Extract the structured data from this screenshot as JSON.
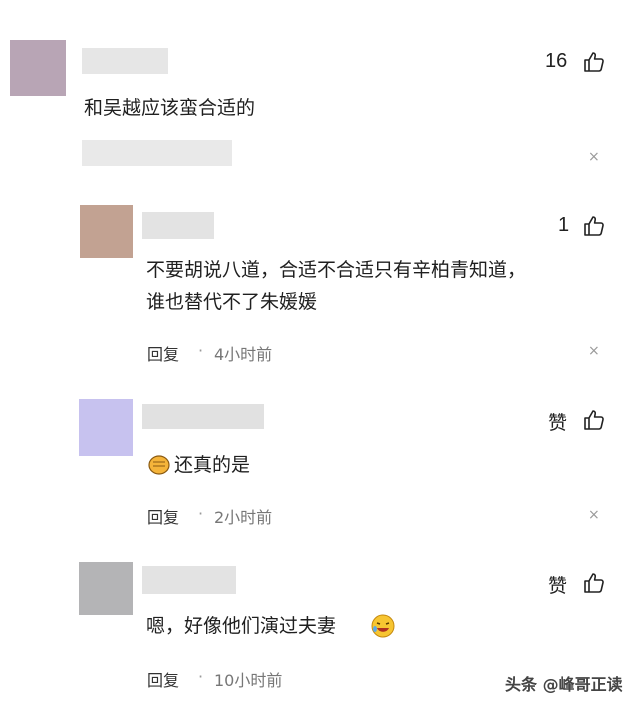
{
  "colors": {
    "avatar1": "#b8a5b5",
    "avatar2": "#c2a292",
    "avatar3": "#c7c2ef",
    "avatar4": "#b4b4b6"
  },
  "comments": [
    {
      "text": "和吴越应该蛮合适的",
      "likes": "16"
    },
    {
      "lines": [
        "不要胡说八道，合适不合适只有辛柏青知道，",
        "谁也替代不了朱媛媛"
      ],
      "likes": "1",
      "reply": "回复",
      "sep": "·",
      "time": "4小时前"
    },
    {
      "text": "还真的是",
      "likes": "赞",
      "reply": "回复",
      "sep": "·",
      "time": "2小时前"
    },
    {
      "text": "嗯，好像他们演过夫妻",
      "likes": "赞",
      "reply": "回复",
      "sep": "·",
      "time": "10小时前"
    }
  ],
  "close_symbol": "×",
  "watermark": "头条 @峰哥正读"
}
